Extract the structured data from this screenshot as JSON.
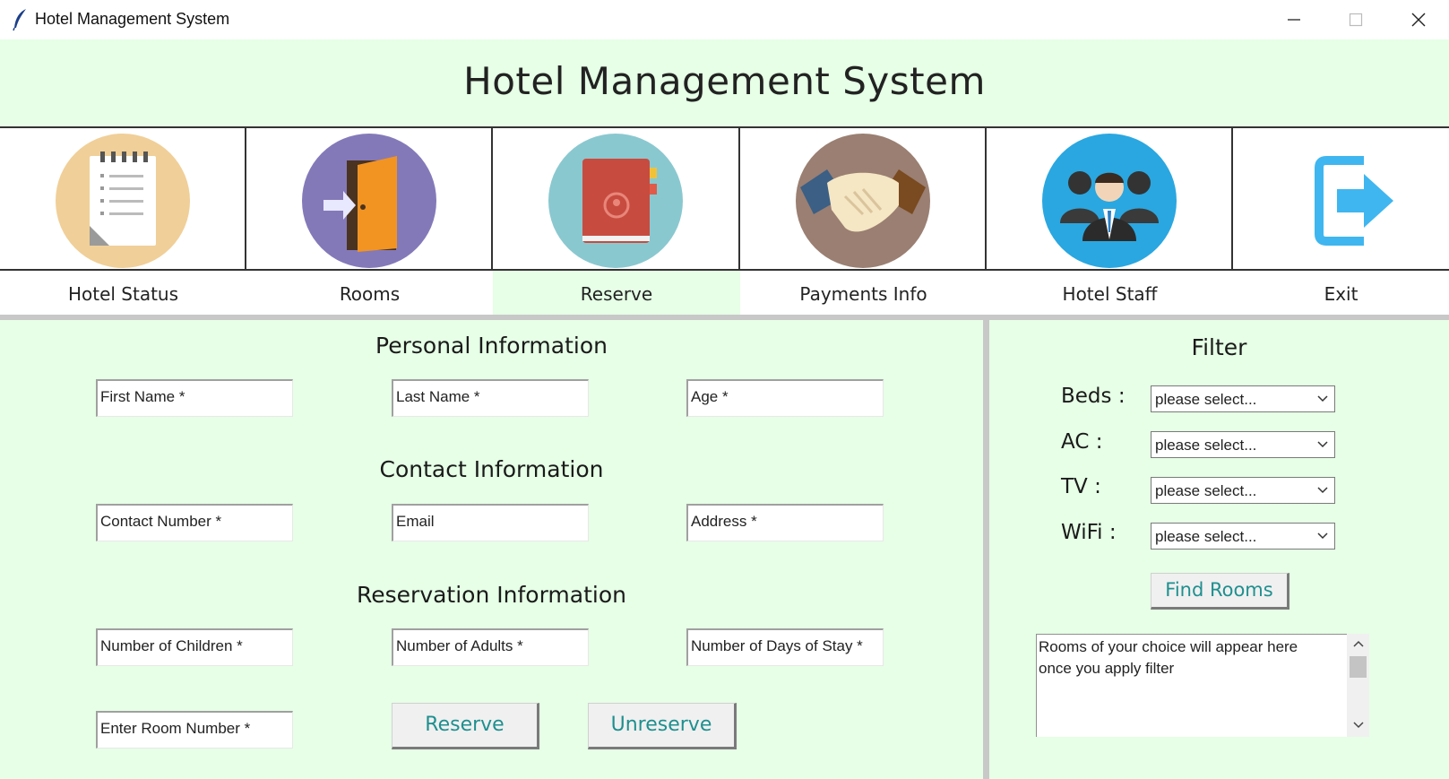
{
  "window": {
    "title": "Hotel Management System",
    "controls": [
      "minimize-icon",
      "maximize-icon",
      "close-icon"
    ]
  },
  "header": {
    "title": "Hotel Management System"
  },
  "nav": {
    "items": [
      {
        "label": "Hotel Status",
        "icon": "notepad-icon",
        "active": false
      },
      {
        "label": "Rooms",
        "icon": "door-icon",
        "active": false
      },
      {
        "label": "Reserve",
        "icon": "address-book-icon",
        "active": true
      },
      {
        "label": "Payments Info",
        "icon": "handshake-icon",
        "active": false
      },
      {
        "label": "Hotel Staff",
        "icon": "staff-icon",
        "active": false
      },
      {
        "label": "Exit",
        "icon": "exit-icon",
        "active": false
      }
    ]
  },
  "form": {
    "personal_title": "Personal Information",
    "contact_title": "Contact Information",
    "reservation_title": "Reservation Information",
    "fields": {
      "first_name": "First Name *",
      "last_name": "Last Name *",
      "age": "Age *",
      "contact_number": "Contact Number *",
      "email": "Email",
      "address": "Address *",
      "num_children": "Number of Children *",
      "num_adults": "Number of Adults *",
      "num_days": "Number of Days of Stay *",
      "room_number": "Enter Room Number *"
    },
    "reserve_label": "Reserve",
    "unreserve_label": "Unreserve"
  },
  "filter": {
    "title": "Filter",
    "beds_label": "Beds :",
    "ac_label": "AC :",
    "tv_label": "TV :",
    "wifi_label": "WiFi :",
    "beds_value": "please select...",
    "ac_value": "please select...",
    "tv_value": "please select...",
    "wifi_value": "please select...",
    "find_label": "Find Rooms",
    "results_line1": "Rooms of your choice will appear here",
    "results_line2": "once you apply filter"
  },
  "colors": {
    "panel_bg": "#e6ffe6",
    "button_text": "#1f8f8f",
    "divider": "#c8c8c8"
  }
}
